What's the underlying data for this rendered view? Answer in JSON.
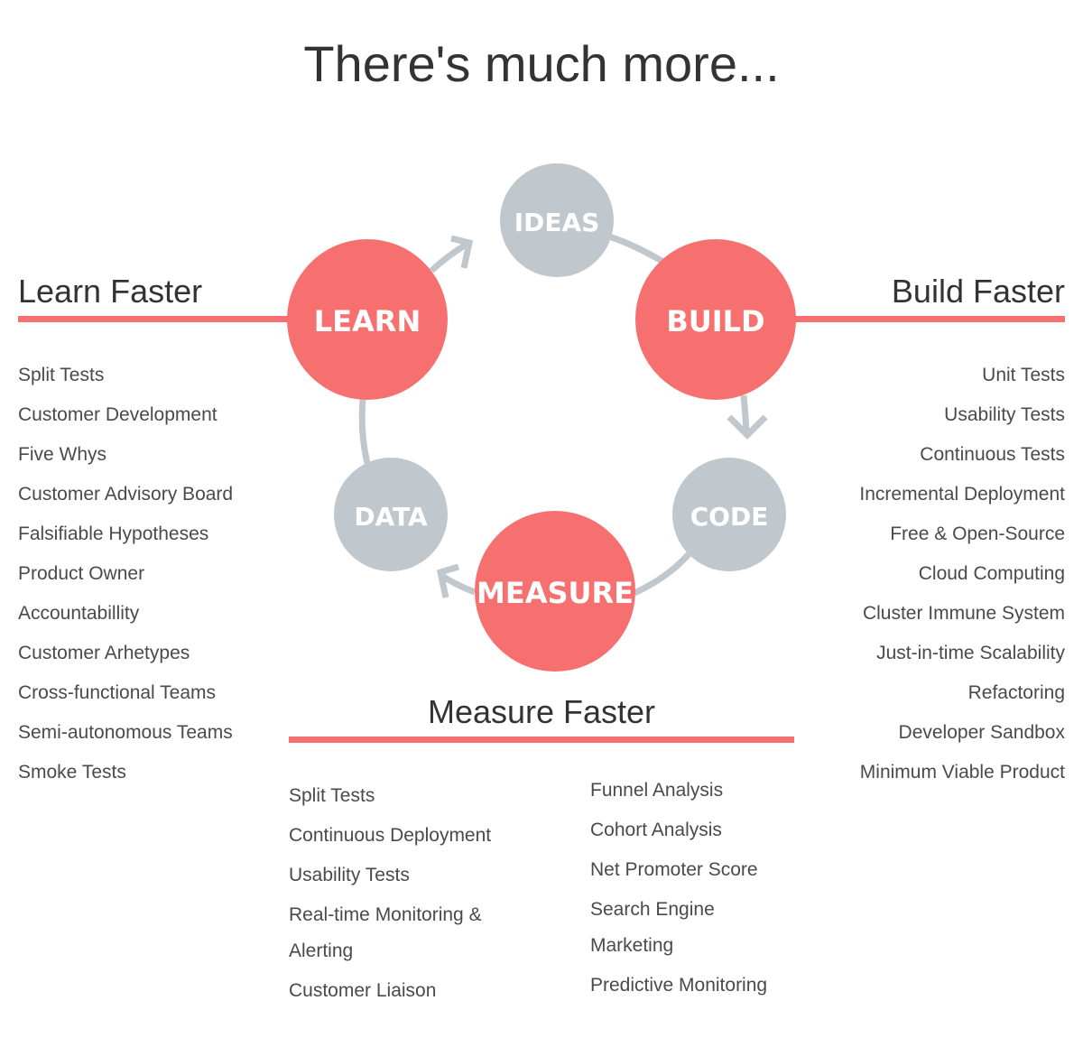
{
  "title": "There's much more...",
  "colors": {
    "accent": "#f77070",
    "node_gray": "#c0c7cd",
    "connector": "#c0c7cd",
    "text": "#444444"
  },
  "cycle": {
    "nodes": [
      {
        "id": "ideas",
        "label": "IDEAS",
        "kind": "secondary"
      },
      {
        "id": "build",
        "label": "BUILD",
        "kind": "primary"
      },
      {
        "id": "code",
        "label": "CODE",
        "kind": "secondary"
      },
      {
        "id": "measure",
        "label": "MEASURE",
        "kind": "primary"
      },
      {
        "id": "data",
        "label": "DATA",
        "kind": "secondary"
      },
      {
        "id": "learn",
        "label": "LEARN",
        "kind": "primary"
      }
    ],
    "flow": [
      [
        "ideas",
        "build"
      ],
      [
        "build",
        "code"
      ],
      [
        "code",
        "measure"
      ],
      [
        "measure",
        "data"
      ],
      [
        "data",
        "learn"
      ],
      [
        "learn",
        "ideas"
      ]
    ]
  },
  "learn": {
    "heading": "Learn Faster",
    "items": [
      "Split Tests",
      "Customer Development",
      "Five Whys",
      "Customer Advisory Board",
      "Falsifiable Hypotheses",
      "Product Owner",
      "Accountabillity",
      "Customer Arhetypes",
      "Cross-functional Teams",
      "Semi-autonomous Teams",
      "Smoke Tests"
    ]
  },
  "build": {
    "heading": "Build Faster",
    "items": [
      "Unit Tests",
      "Usability Tests",
      "Continuous Tests",
      "Incremental Deployment",
      "Free & Open-Source",
      "Cloud Computing",
      "Cluster Immune System",
      "Just-in-time Scalability",
      "Refactoring",
      "Developer Sandbox",
      "Minimum Viable Product"
    ]
  },
  "measure": {
    "heading": "Measure Faster",
    "left_items": [
      "Split Tests",
      "Continuous Deployment",
      "Usability Tests",
      "Real-time Monitoring &",
      "Alerting",
      "Customer Liaison"
    ],
    "right_items": [
      "Funnel Analysis",
      "Cohort Analysis",
      "Net Promoter Score",
      "Search Engine",
      "Marketing",
      "Predictive Monitoring"
    ]
  }
}
